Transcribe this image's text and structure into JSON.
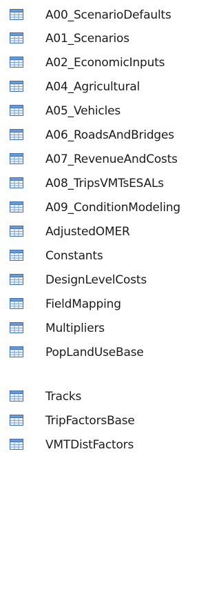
{
  "table_list": {
    "icon": "table-icon",
    "colors": {
      "icon_frame": "#3f6fae",
      "icon_header": "#6b9ad6",
      "icon_cell": "#eef4fc",
      "icon_grid": "#7ea3d3",
      "text": "#1a1a1a"
    },
    "items": [
      {
        "label": "A00_ScenarioDefaults"
      },
      {
        "label": "A01_Scenarios"
      },
      {
        "label": "A02_EconomicInputs"
      },
      {
        "label": "A04_Agricultural"
      },
      {
        "label": "A05_Vehicles"
      },
      {
        "label": "A06_RoadsAndBridges"
      },
      {
        "label": "A07_RevenueAndCosts"
      },
      {
        "label": "A08_TripsVMTsESALs"
      },
      {
        "label": "A09_ConditionModeling"
      },
      {
        "label": "AdjustedOMER"
      },
      {
        "label": "Constants"
      },
      {
        "label": "DesignLevelCosts"
      },
      {
        "label": "FieldMapping"
      },
      {
        "label": "Multipliers"
      },
      {
        "label": "PopLandUseBase"
      },
      {
        "label": "Tracks"
      },
      {
        "label": "TripFactorsBase"
      },
      {
        "label": "VMTDistFactors"
      }
    ]
  }
}
